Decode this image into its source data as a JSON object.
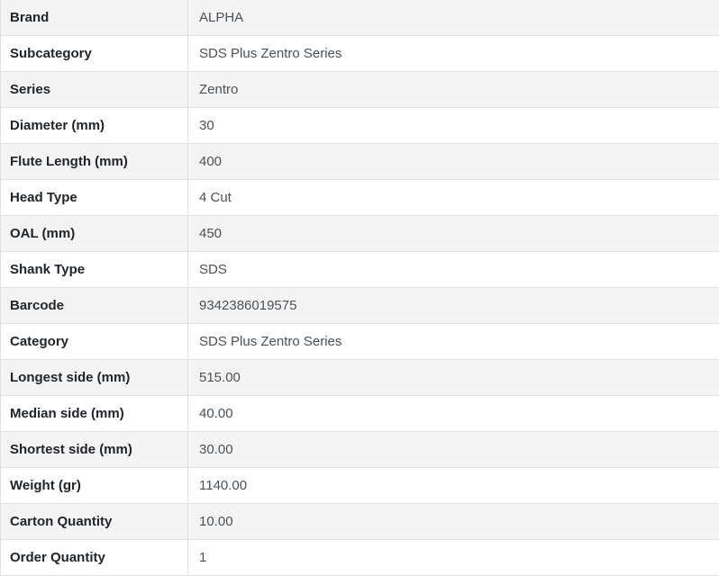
{
  "table": {
    "name": "product-specifications",
    "columns": [
      "attribute",
      "value"
    ],
    "rows": [
      {
        "label": "Brand",
        "value": "ALPHA"
      },
      {
        "label": "Subcategory",
        "value": "SDS Plus Zentro Series"
      },
      {
        "label": "Series",
        "value": "Zentro"
      },
      {
        "label": "Diameter (mm)",
        "value": "30"
      },
      {
        "label": "Flute Length (mm)",
        "value": "400"
      },
      {
        "label": "Head Type",
        "value": "4 Cut"
      },
      {
        "label": "OAL (mm)",
        "value": "450"
      },
      {
        "label": "Shank Type",
        "value": "SDS"
      },
      {
        "label": "Barcode",
        "value": "9342386019575"
      },
      {
        "label": "Category",
        "value": "SDS Plus Zentro Series"
      },
      {
        "label": "Longest side (mm)",
        "value": "515.00"
      },
      {
        "label": "Median side (mm)",
        "value": "40.00"
      },
      {
        "label": "Shortest side (mm)",
        "value": "30.00"
      },
      {
        "label": "Weight (gr)",
        "value": "1140.00"
      },
      {
        "label": "Carton Quantity",
        "value": "10.00"
      },
      {
        "label": "Order Quantity",
        "value": "1"
      }
    ],
    "colors": {
      "stripe_bg": "#f4f4f4",
      "row_bg": "#ffffff",
      "border": "#dee2e6",
      "label_text": "#212529",
      "value_text": "#4b5156"
    }
  }
}
